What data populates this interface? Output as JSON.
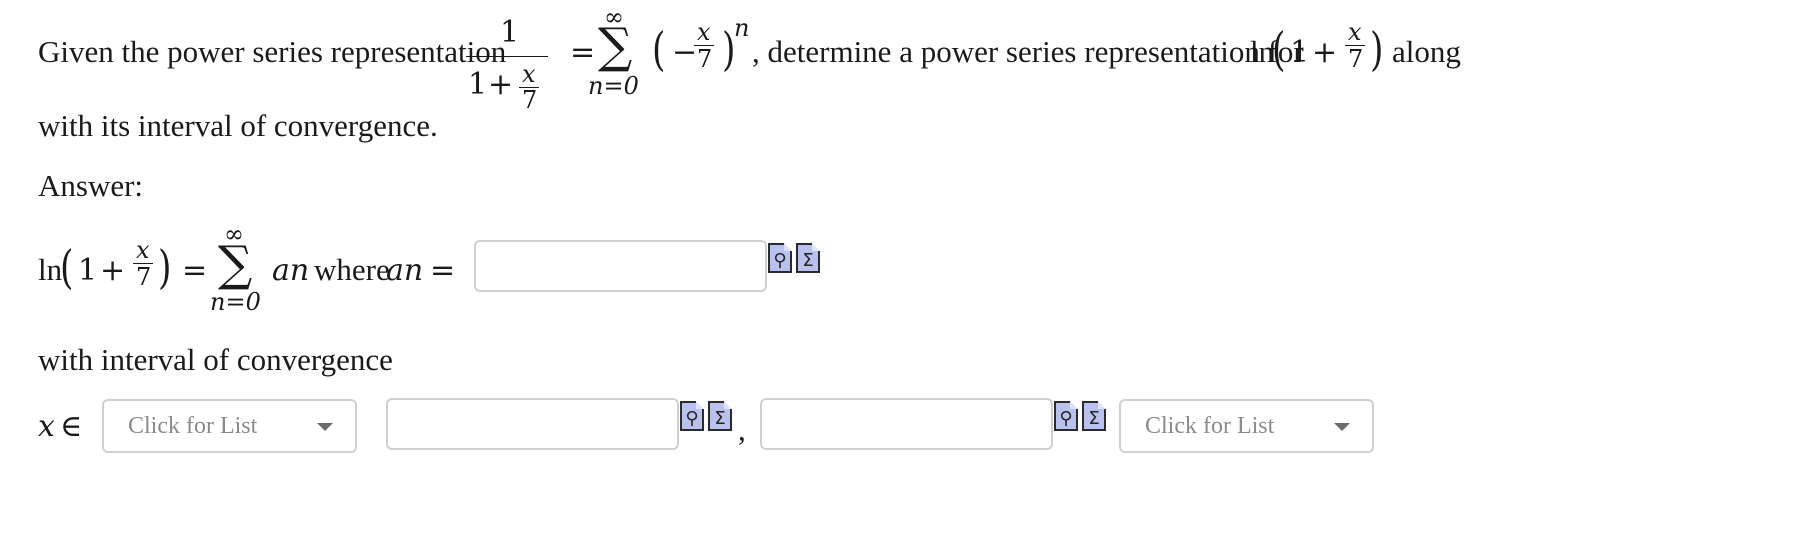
{
  "question": {
    "intro": "Given the power series representation",
    "mid": ", determine a power series representation for",
    "tail": "along",
    "line2": "with its interval of convergence."
  },
  "math": {
    "one": "1",
    "plus": "+",
    "x": "x",
    "seven": "7",
    "minus": "−",
    "equals": "=",
    "sum": "∑",
    "infinity": "∞",
    "n_eq_0": "n=0",
    "n": "n",
    "ln": "ln",
    "a_n": "an",
    "where": "where",
    "in": "∈"
  },
  "answer": {
    "label": "Answer:",
    "a_n_value": "",
    "interval_label": "with interval of convergence",
    "left_bracket_placeholder": "Click for List",
    "right_bracket_placeholder": "Click for List",
    "left_endpoint": "",
    "right_endpoint": "",
    "comma": ","
  },
  "icons": {
    "preview": "preview-icon",
    "equation": "equation-editor-icon",
    "accent": "#b9c2ee"
  }
}
